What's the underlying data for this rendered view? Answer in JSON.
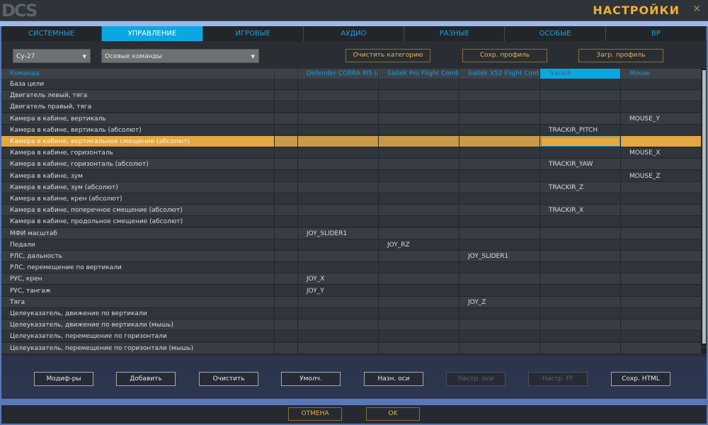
{
  "window": {
    "title": "НАСТРОЙКИ",
    "logo": "DCS",
    "close_icon": "close-icon"
  },
  "tabs": [
    {
      "label": "СИСТЕМНЫЕ"
    },
    {
      "label": "УПРАВЛЕНИЕ",
      "active": true
    },
    {
      "label": "ИГРОВЫЕ"
    },
    {
      "label": "АУДИО"
    },
    {
      "label": "РАЗНЫЕ"
    },
    {
      "label": "ОСОБЫЕ"
    },
    {
      "label": "ВР"
    }
  ],
  "toolbar": {
    "aircraft": "Су-27",
    "category": "Осевые команды",
    "clear_category": "Очистить категорию",
    "save_profile": "Сохр. профиль",
    "load_profile": "Загр. профиль"
  },
  "columns": [
    "Команда",
    "",
    "Defender COBRA M5 USB",
    "Saitek Pro Flight Combat",
    "Saitek X52 Flight Control",
    "TrackIR",
    "Mouse"
  ],
  "selected_column": "TrackIR",
  "rows": [
    [
      "База цели",
      "",
      "",
      "",
      "",
      "",
      ""
    ],
    [
      "Двигатель левый, тяга",
      "",
      "",
      "",
      "",
      "",
      ""
    ],
    [
      "Двигатель правый, тяга",
      "",
      "",
      "",
      "",
      "",
      ""
    ],
    [
      "Камера в кабине, вертикаль",
      "",
      "",
      "",
      "",
      "",
      "MOUSE_Y"
    ],
    [
      "Камера в кабине, вертикаль (абсолют)",
      "",
      "",
      "",
      "",
      "TRACKIR_PITCH",
      ""
    ],
    [
      "Камера в кабине, вертикальное смещение (абсолют)",
      "",
      "",
      "",
      "",
      "",
      ""
    ],
    [
      "Камера в кабине, горизонталь",
      "",
      "",
      "",
      "",
      "",
      "MOUSE_X"
    ],
    [
      "Камера в кабине, горизонталь (абсолют)",
      "",
      "",
      "",
      "",
      "TRACKIR_YAW",
      ""
    ],
    [
      "Камера в кабине, зум",
      "",
      "",
      "",
      "",
      "",
      "MOUSE_Z"
    ],
    [
      "Камера в кабине, зум (абсолют)",
      "",
      "",
      "",
      "",
      "TRACKIR_Z",
      ""
    ],
    [
      "Камера в кабине, крен (абсолют)",
      "",
      "",
      "",
      "",
      "",
      ""
    ],
    [
      "Камера в кабине, поперечное смещение (абсолют)",
      "",
      "",
      "",
      "",
      "TRACKIR_X",
      ""
    ],
    [
      "Камера в кабине, продольное смещение (абсолют)",
      "",
      "",
      "",
      "",
      "",
      ""
    ],
    [
      "МФИ масштаб",
      "",
      "JOY_SLIDER1",
      "",
      "",
      "",
      ""
    ],
    [
      "Педали",
      "",
      "",
      "JOY_RZ",
      "",
      "",
      ""
    ],
    [
      "РЛС, дальность",
      "",
      "",
      "",
      "JOY_SLIDER1",
      "",
      ""
    ],
    [
      "РЛС, перемещение по вертикали",
      "",
      "",
      "",
      "",
      "",
      ""
    ],
    [
      "РУС, крен",
      "",
      "JOY_X",
      "",
      "",
      "",
      ""
    ],
    [
      "РУС, тангаж",
      "",
      "JOY_Y",
      "",
      "",
      "",
      ""
    ],
    [
      "Тяга",
      "",
      "",
      "",
      "JOY_Z",
      "",
      ""
    ],
    [
      "Целеуказатель, движение по вертикали",
      "",
      "",
      "",
      "",
      "",
      ""
    ],
    [
      "Целеуказатель, движение по вертикали (мышь)",
      "",
      "",
      "",
      "",
      "",
      ""
    ],
    [
      "Целеуказатель, перемещение по горизонтали",
      "",
      "",
      "",
      "",
      "",
      ""
    ],
    [
      "Целеуказатель, перемещение по горизонтали (мышь)",
      "",
      "",
      "",
      "",
      "",
      ""
    ]
  ],
  "selected_row": 5,
  "actions": [
    {
      "label": "Модиф-ры",
      "enabled": true
    },
    {
      "label": "Добавить",
      "enabled": true
    },
    {
      "label": "Очистить",
      "enabled": true
    },
    {
      "label": "Умолч.",
      "enabled": true
    },
    {
      "label": "Назн. оси",
      "enabled": true
    },
    {
      "label": "Настр. оси",
      "enabled": false
    },
    {
      "label": "Настр. FF",
      "enabled": false
    },
    {
      "label": "Сохр. HTML",
      "enabled": true
    }
  ],
  "footer": {
    "cancel": "ОТМЕНА",
    "ok": "OK"
  },
  "colors": {
    "accent": "#0aa8e0",
    "highlight": "#e4a840",
    "title": "#f0b030"
  }
}
